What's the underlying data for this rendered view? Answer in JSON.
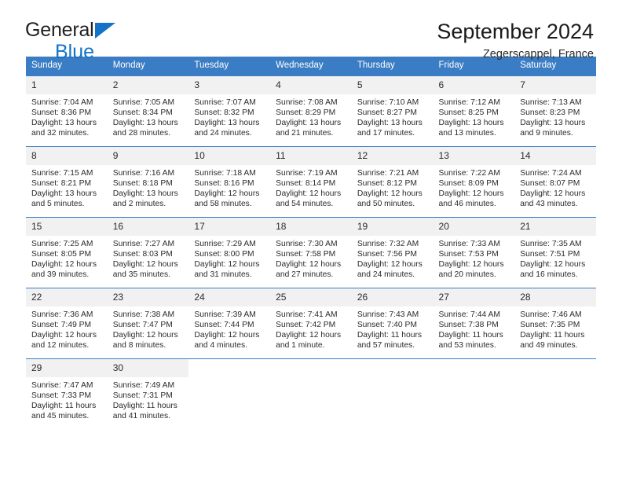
{
  "brand": {
    "name_part1": "General",
    "name_part2": "Blue",
    "icon": "triangle-logo"
  },
  "header": {
    "title": "September 2024",
    "subtitle": "Zegerscappel, France"
  },
  "calendar": {
    "weekday_headers": [
      "Sunday",
      "Monday",
      "Tuesday",
      "Wednesday",
      "Thursday",
      "Friday",
      "Saturday"
    ],
    "accent_color": "#3b7dc4",
    "daynum_band_color": "#f1f1f1",
    "weeks": [
      [
        {
          "day": "1",
          "sunrise": "Sunrise: 7:04 AM",
          "sunset": "Sunset: 8:36 PM",
          "daylight": "Daylight: 13 hours and 32 minutes."
        },
        {
          "day": "2",
          "sunrise": "Sunrise: 7:05 AM",
          "sunset": "Sunset: 8:34 PM",
          "daylight": "Daylight: 13 hours and 28 minutes."
        },
        {
          "day": "3",
          "sunrise": "Sunrise: 7:07 AM",
          "sunset": "Sunset: 8:32 PM",
          "daylight": "Daylight: 13 hours and 24 minutes."
        },
        {
          "day": "4",
          "sunrise": "Sunrise: 7:08 AM",
          "sunset": "Sunset: 8:29 PM",
          "daylight": "Daylight: 13 hours and 21 minutes."
        },
        {
          "day": "5",
          "sunrise": "Sunrise: 7:10 AM",
          "sunset": "Sunset: 8:27 PM",
          "daylight": "Daylight: 13 hours and 17 minutes."
        },
        {
          "day": "6",
          "sunrise": "Sunrise: 7:12 AM",
          "sunset": "Sunset: 8:25 PM",
          "daylight": "Daylight: 13 hours and 13 minutes."
        },
        {
          "day": "7",
          "sunrise": "Sunrise: 7:13 AM",
          "sunset": "Sunset: 8:23 PM",
          "daylight": "Daylight: 13 hours and 9 minutes."
        }
      ],
      [
        {
          "day": "8",
          "sunrise": "Sunrise: 7:15 AM",
          "sunset": "Sunset: 8:21 PM",
          "daylight": "Daylight: 13 hours and 5 minutes."
        },
        {
          "day": "9",
          "sunrise": "Sunrise: 7:16 AM",
          "sunset": "Sunset: 8:18 PM",
          "daylight": "Daylight: 13 hours and 2 minutes."
        },
        {
          "day": "10",
          "sunrise": "Sunrise: 7:18 AM",
          "sunset": "Sunset: 8:16 PM",
          "daylight": "Daylight: 12 hours and 58 minutes."
        },
        {
          "day": "11",
          "sunrise": "Sunrise: 7:19 AM",
          "sunset": "Sunset: 8:14 PM",
          "daylight": "Daylight: 12 hours and 54 minutes."
        },
        {
          "day": "12",
          "sunrise": "Sunrise: 7:21 AM",
          "sunset": "Sunset: 8:12 PM",
          "daylight": "Daylight: 12 hours and 50 minutes."
        },
        {
          "day": "13",
          "sunrise": "Sunrise: 7:22 AM",
          "sunset": "Sunset: 8:09 PM",
          "daylight": "Daylight: 12 hours and 46 minutes."
        },
        {
          "day": "14",
          "sunrise": "Sunrise: 7:24 AM",
          "sunset": "Sunset: 8:07 PM",
          "daylight": "Daylight: 12 hours and 43 minutes."
        }
      ],
      [
        {
          "day": "15",
          "sunrise": "Sunrise: 7:25 AM",
          "sunset": "Sunset: 8:05 PM",
          "daylight": "Daylight: 12 hours and 39 minutes."
        },
        {
          "day": "16",
          "sunrise": "Sunrise: 7:27 AM",
          "sunset": "Sunset: 8:03 PM",
          "daylight": "Daylight: 12 hours and 35 minutes."
        },
        {
          "day": "17",
          "sunrise": "Sunrise: 7:29 AM",
          "sunset": "Sunset: 8:00 PM",
          "daylight": "Daylight: 12 hours and 31 minutes."
        },
        {
          "day": "18",
          "sunrise": "Sunrise: 7:30 AM",
          "sunset": "Sunset: 7:58 PM",
          "daylight": "Daylight: 12 hours and 27 minutes."
        },
        {
          "day": "19",
          "sunrise": "Sunrise: 7:32 AM",
          "sunset": "Sunset: 7:56 PM",
          "daylight": "Daylight: 12 hours and 24 minutes."
        },
        {
          "day": "20",
          "sunrise": "Sunrise: 7:33 AM",
          "sunset": "Sunset: 7:53 PM",
          "daylight": "Daylight: 12 hours and 20 minutes."
        },
        {
          "day": "21",
          "sunrise": "Sunrise: 7:35 AM",
          "sunset": "Sunset: 7:51 PM",
          "daylight": "Daylight: 12 hours and 16 minutes."
        }
      ],
      [
        {
          "day": "22",
          "sunrise": "Sunrise: 7:36 AM",
          "sunset": "Sunset: 7:49 PM",
          "daylight": "Daylight: 12 hours and 12 minutes."
        },
        {
          "day": "23",
          "sunrise": "Sunrise: 7:38 AM",
          "sunset": "Sunset: 7:47 PM",
          "daylight": "Daylight: 12 hours and 8 minutes."
        },
        {
          "day": "24",
          "sunrise": "Sunrise: 7:39 AM",
          "sunset": "Sunset: 7:44 PM",
          "daylight": "Daylight: 12 hours and 4 minutes."
        },
        {
          "day": "25",
          "sunrise": "Sunrise: 7:41 AM",
          "sunset": "Sunset: 7:42 PM",
          "daylight": "Daylight: 12 hours and 1 minute."
        },
        {
          "day": "26",
          "sunrise": "Sunrise: 7:43 AM",
          "sunset": "Sunset: 7:40 PM",
          "daylight": "Daylight: 11 hours and 57 minutes."
        },
        {
          "day": "27",
          "sunrise": "Sunrise: 7:44 AM",
          "sunset": "Sunset: 7:38 PM",
          "daylight": "Daylight: 11 hours and 53 minutes."
        },
        {
          "day": "28",
          "sunrise": "Sunrise: 7:46 AM",
          "sunset": "Sunset: 7:35 PM",
          "daylight": "Daylight: 11 hours and 49 minutes."
        }
      ],
      [
        {
          "day": "29",
          "sunrise": "Sunrise: 7:47 AM",
          "sunset": "Sunset: 7:33 PM",
          "daylight": "Daylight: 11 hours and 45 minutes."
        },
        {
          "day": "30",
          "sunrise": "Sunrise: 7:49 AM",
          "sunset": "Sunset: 7:31 PM",
          "daylight": "Daylight: 11 hours and 41 minutes."
        },
        {
          "day": "",
          "sunrise": "",
          "sunset": "",
          "daylight": ""
        },
        {
          "day": "",
          "sunrise": "",
          "sunset": "",
          "daylight": ""
        },
        {
          "day": "",
          "sunrise": "",
          "sunset": "",
          "daylight": ""
        },
        {
          "day": "",
          "sunrise": "",
          "sunset": "",
          "daylight": ""
        },
        {
          "day": "",
          "sunrise": "",
          "sunset": "",
          "daylight": ""
        }
      ]
    ]
  }
}
